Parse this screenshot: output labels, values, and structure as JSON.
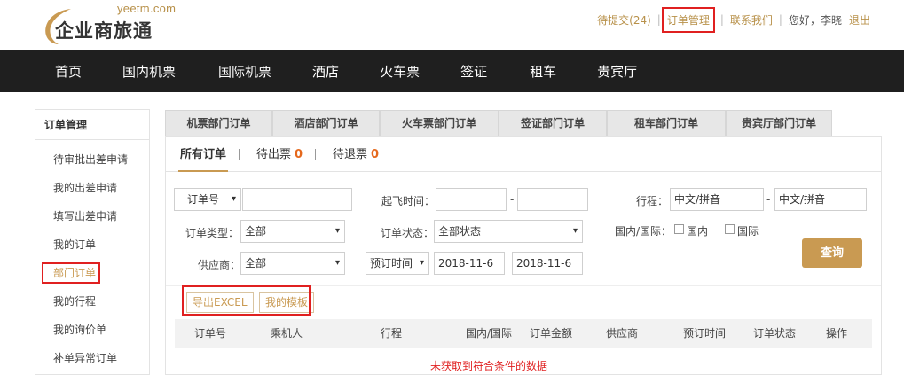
{
  "header": {
    "logo_domain": "yeetm.com",
    "logo_name": "企业商旅通",
    "links": {
      "pending": "待提交(24)",
      "orders": "订单管理",
      "contact": "联系我们",
      "greeting": "您好，李晓",
      "logout": "退出"
    }
  },
  "nav": {
    "items": [
      "首页",
      "国内机票",
      "国际机票",
      "酒店",
      "火车票",
      "签证",
      "租车",
      "贵宾厅"
    ]
  },
  "sidebar": {
    "title": "订单管理",
    "items": [
      "待审批出差申请",
      "我的出差申请",
      "填写出差申请",
      "我的订单",
      "部门订单",
      "我的行程",
      "我的询价单",
      "补单异常订单"
    ]
  },
  "dept_tabs": [
    "机票部门订单",
    "酒店部门订单",
    "火车票部门订单",
    "签证部门订单",
    "租车部门订单",
    "贵宾厅部门订单"
  ],
  "sub_tabs": {
    "all": "所有订单",
    "pending_ticket": "待出票",
    "pending_ticket_count": "0",
    "pending_refund": "待退票",
    "pending_refund_count": "0"
  },
  "filters": {
    "order_no_select": "订单号",
    "order_no_value": "",
    "departure_label": "起飞时间：",
    "departure_from": "",
    "departure_to": "",
    "route_label": "行程：",
    "route_from": "中文/拼音",
    "route_to": "中文/拼音",
    "order_type_label": "订单类型：",
    "order_type_value": "全部",
    "order_status_label": "订单状态：",
    "order_status_value": "全部状态",
    "domestic_label": "国内/国际：",
    "domestic_option": "国内",
    "intl_option": "国际",
    "supplier_label": "供应商：",
    "supplier_value": "全部",
    "booking_time_select": "预订时间",
    "booking_from": "2018-11-6",
    "booking_to": "2018-11-6",
    "dash": "-",
    "query_label": "查询"
  },
  "actions": {
    "export": "导出EXCEL",
    "template": "我的模板"
  },
  "table": {
    "columns": [
      "订单号",
      "乘机人",
      "行程",
      "国内/国际",
      "订单金额",
      "供应商",
      "预订时间",
      "订单状态",
      "操作"
    ],
    "empty_message": "未获取到符合条件的数据"
  },
  "colors": {
    "accent": "#c99a52",
    "nav_bg": "#1f1f1f",
    "highlight_red": "#e02020",
    "count_orange": "#e5681c"
  }
}
